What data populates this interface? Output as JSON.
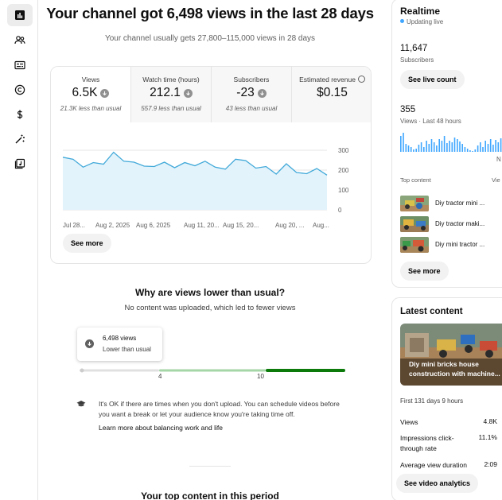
{
  "nav": {
    "items": [
      {
        "icon": "analytics-icon",
        "active": true
      },
      {
        "icon": "audience-icon",
        "active": false
      },
      {
        "icon": "subtitles-icon",
        "active": false
      },
      {
        "icon": "copyright-icon",
        "active": false
      },
      {
        "icon": "earn-icon",
        "active": false
      },
      {
        "icon": "customization-icon",
        "active": false
      },
      {
        "icon": "audio-library-icon",
        "active": false
      }
    ]
  },
  "overview": {
    "headline": "Your channel got 6,498 views in the last 28 days",
    "subline": "Your channel usually gets 27,800–115,000 views in 28 days"
  },
  "metrics": [
    {
      "label": "Views",
      "value": "6.5K",
      "note": "21.3K less than usual",
      "trend": "down",
      "active": true
    },
    {
      "label": "Watch time (hours)",
      "value": "212.1",
      "note": "557.9 less than usual",
      "trend": "down",
      "active": false
    },
    {
      "label": "Subscribers",
      "value": "-23",
      "note": "43 less than usual",
      "trend": "down",
      "active": false
    },
    {
      "label": "Estimated revenue",
      "value": "$0.15",
      "note": "",
      "trend": "none",
      "active": false
    }
  ],
  "chart_data": {
    "type": "area",
    "series": [
      {
        "values": [
          265,
          255,
          215,
          238,
          230,
          290,
          245,
          240,
          220,
          218,
          240,
          212,
          238,
          222,
          245,
          215,
          205,
          255,
          248,
          210,
          218,
          180,
          232,
          188,
          182,
          208,
          175
        ]
      }
    ],
    "ylim": [
      0,
      300
    ],
    "yticks": [
      "300",
      "200",
      "100",
      "0"
    ],
    "xticks": [
      "Jul 28...",
      "Aug 2, 2025",
      "Aug 6, 2025",
      "Aug 11, 20...",
      "Aug 15, 20...",
      "Aug 20, ...",
      "Aug..."
    ],
    "colors": {
      "line": "#41a9d9",
      "fill": "#e3f3fb",
      "grid": "#e5e5e5"
    }
  },
  "chart_see_more": "See more",
  "why": {
    "title": "Why are views lower than usual?",
    "subtitle": "No content was uploaded, which led to fewer views",
    "tooltip_views": "6,498 views",
    "tooltip_label": "Lower than usual",
    "range": {
      "current": 6498,
      "min": 0,
      "typical_low": 27800,
      "typical_high": 115000
    },
    "range_ticks": [
      "4",
      "10"
    ],
    "colors": {
      "low": "#a5d6a7",
      "high": "#0b7a0b",
      "empty": "#e0e0e0"
    },
    "tip_text": "It's OK if there are times when you don't upload. You can schedule videos before you want a break or let your audience know you're taking time off.",
    "tip_link": "Learn more about balancing work and life"
  },
  "top_content_title": "Your top content in this period",
  "realtime": {
    "title": "Realtime",
    "live_label": "Updating live",
    "subscribers": "11,647",
    "subscribers_label": "Subscribers",
    "live_count_button": "See live count",
    "views": "355",
    "views_label": "Views · Last 48 hours",
    "spark_values": [
      20,
      24,
      10,
      8,
      6,
      3,
      4,
      9,
      12,
      6,
      14,
      10,
      16,
      12,
      8,
      16,
      14,
      20,
      11,
      14,
      12,
      18,
      16,
      13,
      10,
      6,
      4,
      2,
      1,
      3,
      8,
      12,
      6,
      14,
      10,
      16,
      9,
      15,
      12,
      17
    ],
    "spark_suffix": "N",
    "top_content_label": "Top content",
    "top_content_col": "Vie",
    "top_items": [
      {
        "title": "Diy tractor mini ..."
      },
      {
        "title": "Diy tractor maki..."
      },
      {
        "title": "Diy mini tractor ..."
      }
    ],
    "see_more": "See more",
    "colors": {
      "accent": "#3ea6ff"
    }
  },
  "latest": {
    "title": "Latest content",
    "video_title": "Diy mini bricks house construction with machine...",
    "age": "First 131 days 9 hours",
    "stats": [
      {
        "label": "Views",
        "value": "4.8K"
      },
      {
        "label": "Impressions click-through rate",
        "value": "11.1%"
      },
      {
        "label": "Average view duration",
        "value": "2:09"
      }
    ],
    "analytics_button": "See video analytics"
  }
}
